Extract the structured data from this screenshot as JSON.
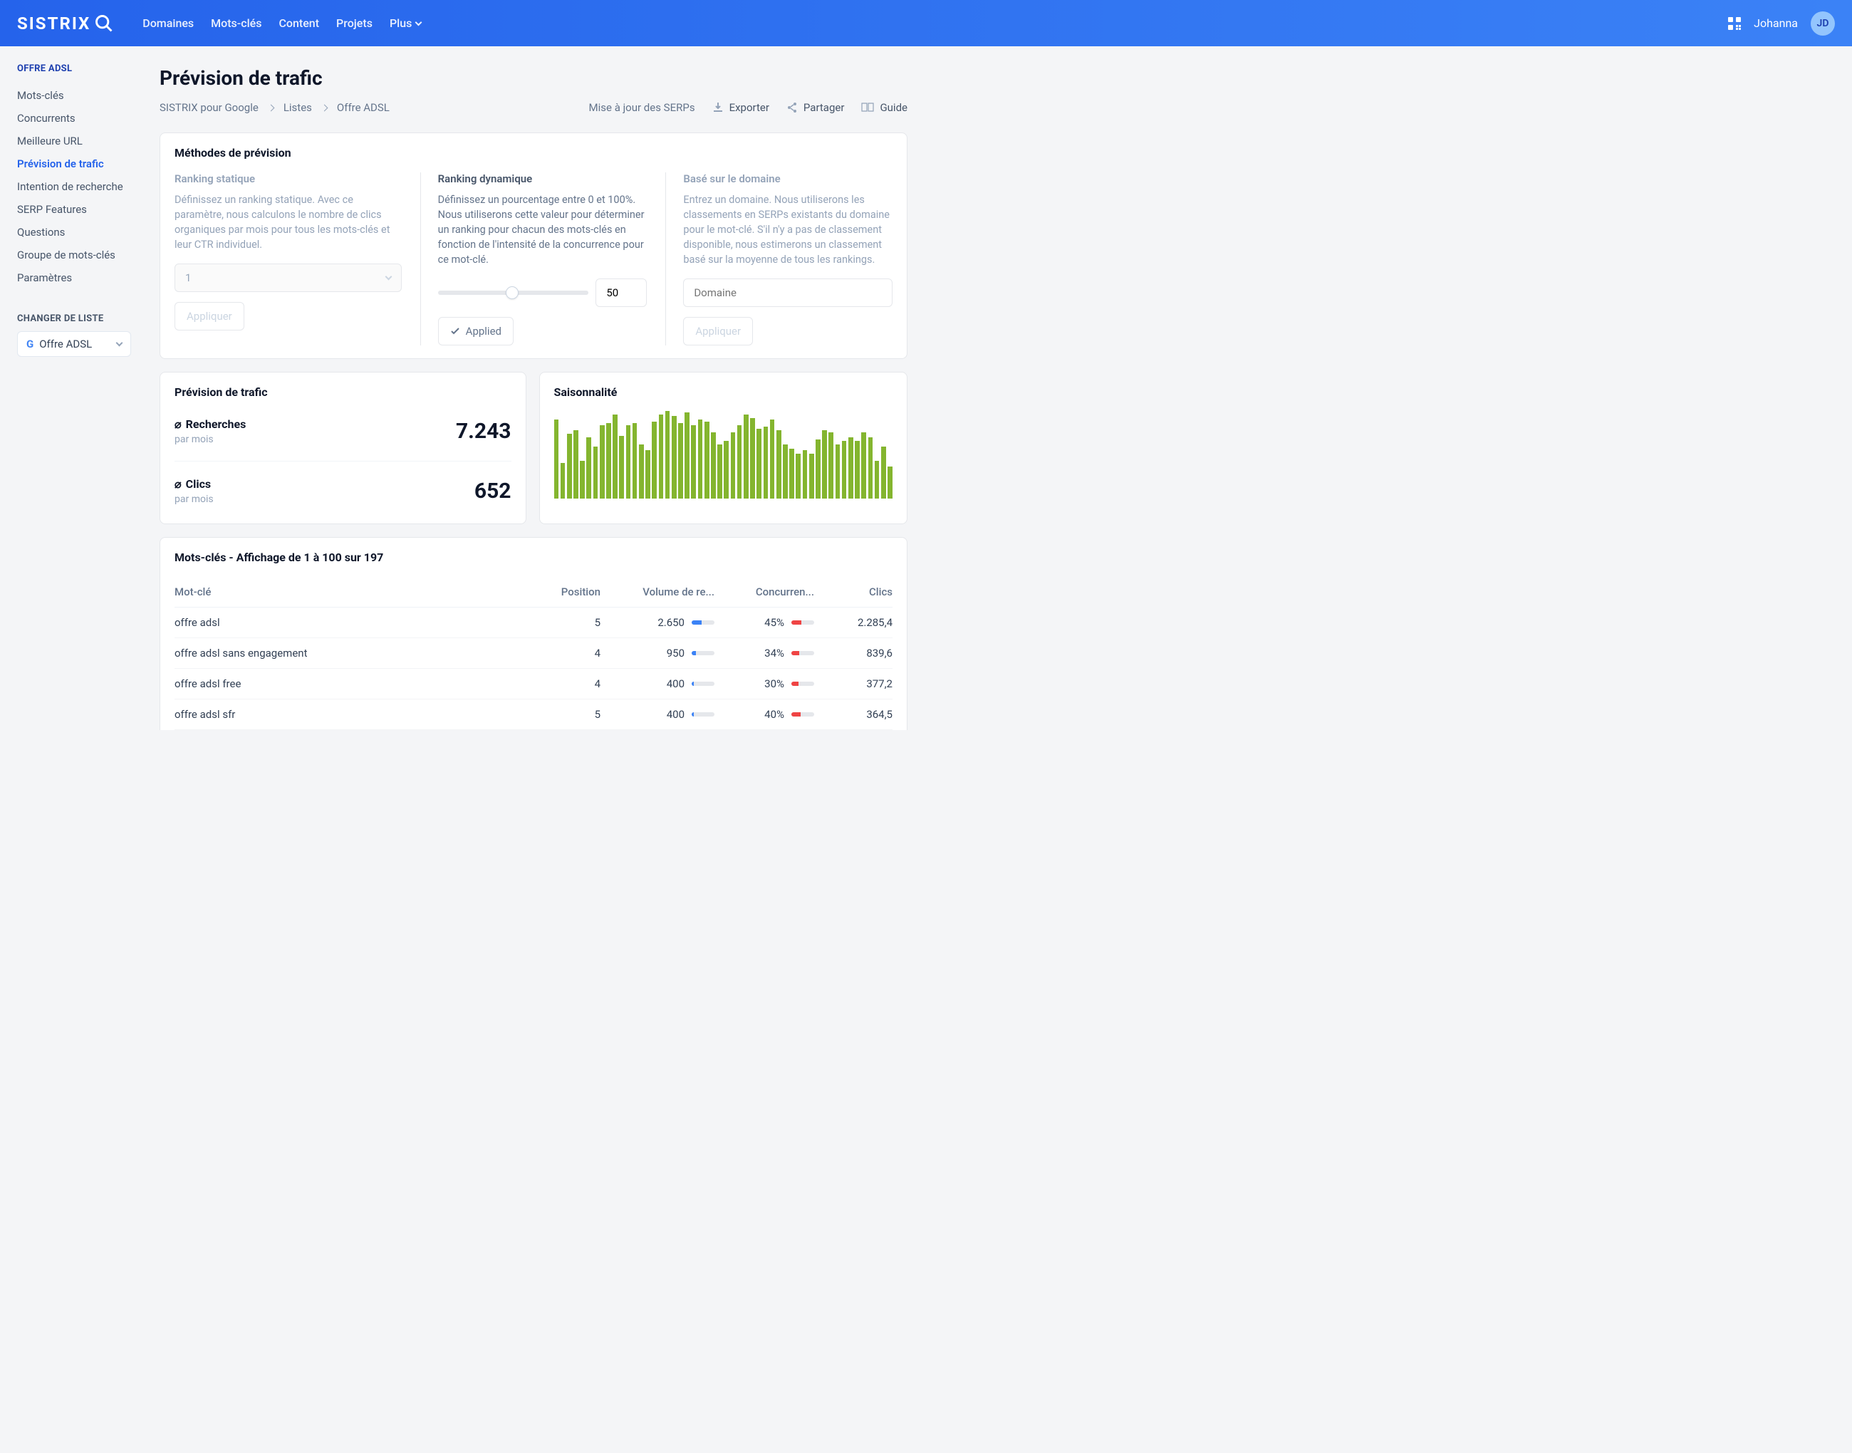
{
  "header": {
    "logo": "SISTRIX",
    "nav": [
      "Domaines",
      "Mots-clés",
      "Content",
      "Projets",
      "Plus"
    ],
    "username": "Johanna",
    "avatar": "JD"
  },
  "sidebar": {
    "title": "OFFRE ADSL",
    "items": [
      {
        "label": "Mots-clés",
        "active": false
      },
      {
        "label": "Concurrents",
        "active": false
      },
      {
        "label": "Meilleure URL",
        "active": false
      },
      {
        "label": "Prévision de trafic",
        "active": true
      },
      {
        "label": "Intention de recherche",
        "active": false
      },
      {
        "label": "SERP Features",
        "active": false
      },
      {
        "label": "Questions",
        "active": false
      },
      {
        "label": "Groupe de mots-clés",
        "active": false
      },
      {
        "label": "Paramètres",
        "active": false
      }
    ],
    "changeListLabel": "CHANGER DE LISTE",
    "selectedList": "Offre ADSL"
  },
  "page": {
    "title": "Prévision de trafic",
    "breadcrumb": [
      "SISTRIX pour Google",
      "Listes",
      "Offre ADSL"
    ],
    "serpUpdate": "Mise à jour des SERPs",
    "actions": {
      "export": "Exporter",
      "share": "Partager",
      "guide": "Guide"
    }
  },
  "methods": {
    "title": "Méthodes de prévision",
    "static": {
      "title": "Ranking statique",
      "desc": "Définissez un ranking statique. Avec ce paramètre, nous calculons le nombre de clics organiques par mois pour tous les mots-clés et leur CTR individuel.",
      "value": "1",
      "apply": "Appliquer"
    },
    "dynamic": {
      "title": "Ranking dynamique",
      "desc": "Définissez un pourcentage entre 0 et 100%. Nous utiliserons cette valeur pour déterminer un ranking pour chacun des mots-clés en fonction de l'intensité de la concurrence pour ce mot-clé.",
      "value": "50",
      "applied": "Applied"
    },
    "domain": {
      "title": "Basé sur le domaine",
      "desc": "Entrez un domaine. Nous utiliserons les classements en SERPs existants du domaine pour le mot-clé. S'il n'y a pas de classement disponible, nous estimerons un classement basé sur la moyenne de tous les rankings.",
      "placeholder": "Domaine",
      "apply": "Appliquer"
    }
  },
  "forecast": {
    "title": "Prévision de trafic",
    "searches": {
      "label": "Recherches",
      "sub": "par mois",
      "value": "7.243"
    },
    "clicks": {
      "label": "Clics",
      "sub": "par mois",
      "value": "652"
    }
  },
  "seasonality": {
    "title": "Saisonnalité"
  },
  "chart_data": {
    "type": "bar",
    "title": "Saisonnalité",
    "xlabel": "",
    "ylabel": "",
    "ylim": [
      0,
      100
    ],
    "values": [
      88,
      40,
      72,
      76,
      42,
      68,
      58,
      82,
      84,
      94,
      70,
      82,
      84,
      60,
      54,
      86,
      94,
      98,
      92,
      84,
      96,
      82,
      88,
      86,
      74,
      60,
      64,
      74,
      82,
      94,
      90,
      78,
      80,
      88,
      76,
      60,
      56,
      50,
      54,
      50,
      66,
      76,
      74,
      60,
      64,
      68,
      64,
      74,
      68,
      42,
      58,
      36
    ]
  },
  "table": {
    "title": "Mots-clés - Affichage de 1 à 100 sur 197",
    "headers": {
      "keyword": "Mot-clé",
      "position": "Position",
      "volume": "Volume de re...",
      "competition": "Concurren...",
      "clicks": "Clics"
    },
    "rows": [
      {
        "keyword": "offre adsl",
        "position": "5",
        "volume": "2.650",
        "volumePct": 45,
        "competition": "45%",
        "competitionPct": 45,
        "clicks": "2.285,4"
      },
      {
        "keyword": "offre adsl sans engagement",
        "position": "4",
        "volume": "950",
        "volumePct": 20,
        "competition": "34%",
        "competitionPct": 34,
        "clicks": "839,6"
      },
      {
        "keyword": "offre adsl free",
        "position": "4",
        "volume": "400",
        "volumePct": 10,
        "competition": "30%",
        "competitionPct": 30,
        "clicks": "377,2"
      },
      {
        "keyword": "offre adsl sfr",
        "position": "5",
        "volume": "400",
        "volumePct": 10,
        "competition": "40%",
        "competitionPct": 40,
        "clicks": "364,5"
      }
    ]
  }
}
